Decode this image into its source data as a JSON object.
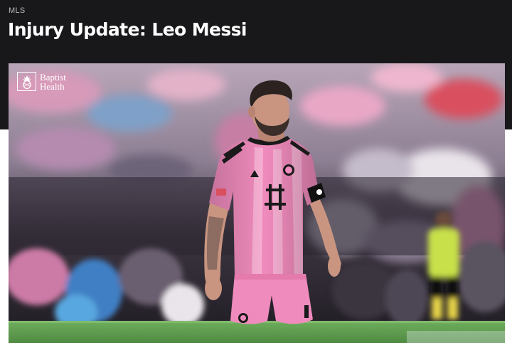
{
  "header": {
    "category": "MLS",
    "title": "Injury Update: Leo Messi"
  },
  "hero": {
    "sponsor": {
      "line1": "Baptist",
      "line2": "Health",
      "icon": "pineapple-icon"
    },
    "image_subject": "player-photo",
    "colors": {
      "kit_pink": "#f08bbd",
      "kit_stripe": "#f6b2d3",
      "kit_black": "#1a1a1a",
      "pitch_green": "#5f9a4f",
      "header_bg": "#18181a"
    }
  }
}
